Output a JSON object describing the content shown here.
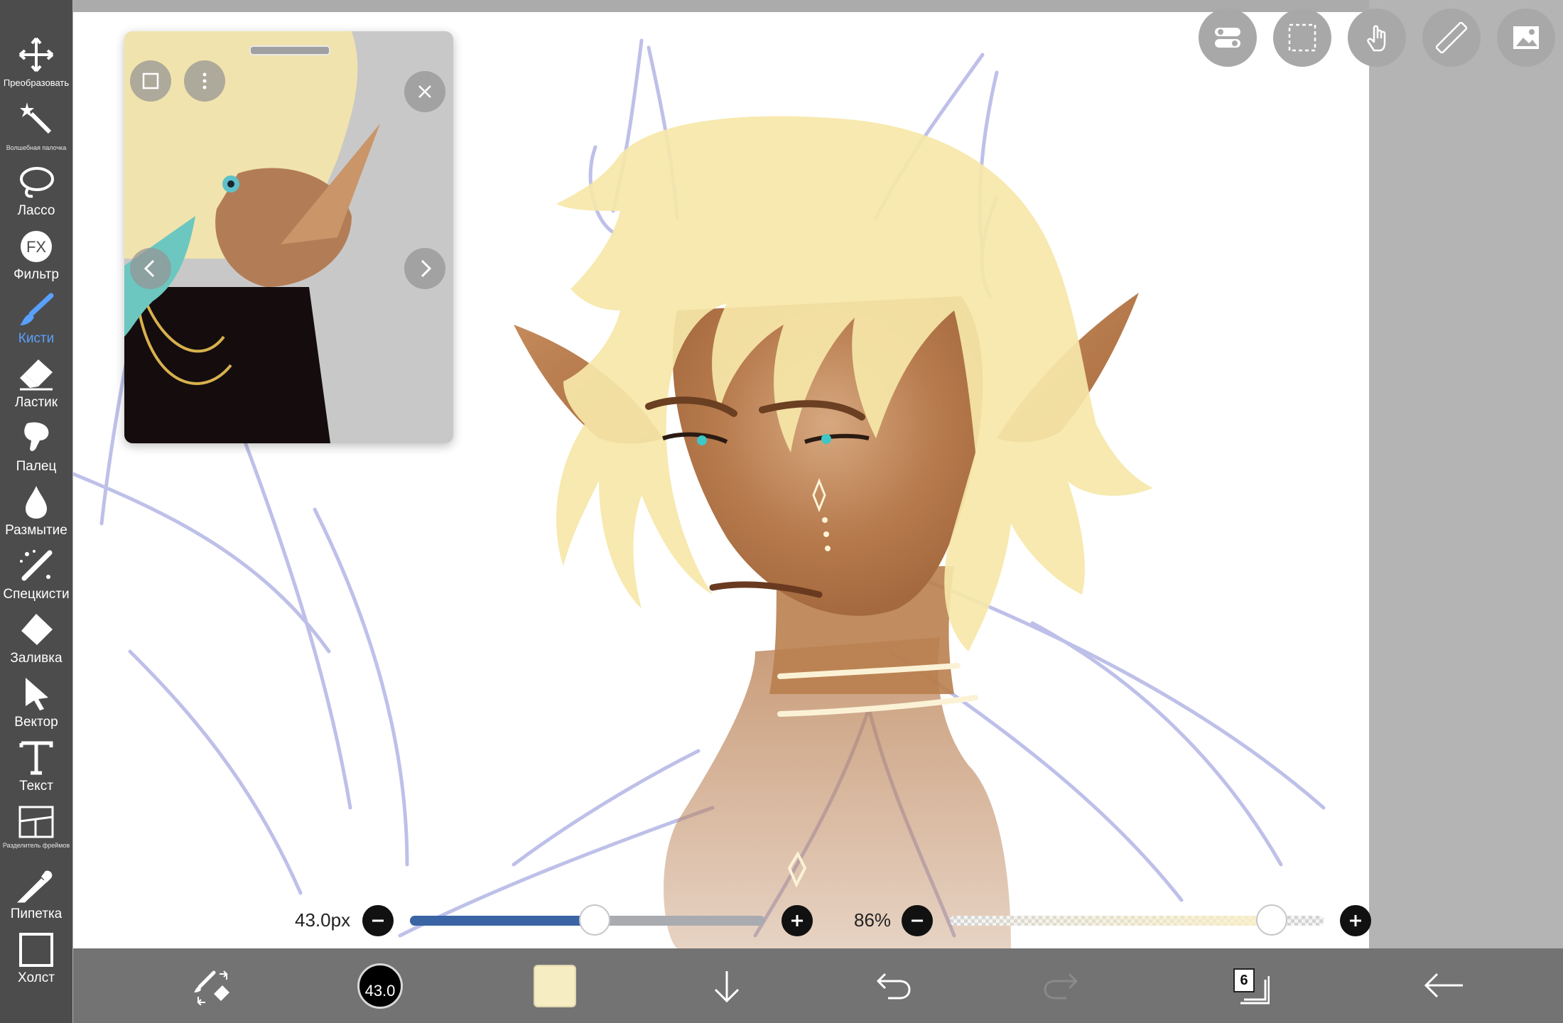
{
  "sidebar": {
    "tools": [
      {
        "id": "transform",
        "label": "Преобразовать",
        "icon": "move-arrows-icon"
      },
      {
        "id": "magic-wand",
        "label": "Волшебная палочка",
        "icon": "magic-wand-icon"
      },
      {
        "id": "lasso",
        "label": "Лассо",
        "icon": "lasso-icon"
      },
      {
        "id": "filter",
        "label": "Фильтр",
        "icon": "fx-icon"
      },
      {
        "id": "brush",
        "label": "Кисти",
        "icon": "brush-icon",
        "active": true
      },
      {
        "id": "eraser",
        "label": "Ластик",
        "icon": "eraser-icon"
      },
      {
        "id": "finger",
        "label": "Палец",
        "icon": "smudge-finger-icon"
      },
      {
        "id": "blur",
        "label": "Размытие",
        "icon": "blur-drop-icon"
      },
      {
        "id": "special-brush",
        "label": "Спецкисти",
        "icon": "special-brush-icon"
      },
      {
        "id": "fill",
        "label": "Заливка",
        "icon": "fill-bucket-icon"
      },
      {
        "id": "vector",
        "label": "Вектор",
        "icon": "vector-cursor-icon"
      },
      {
        "id": "text",
        "label": "Текст",
        "icon": "text-T-icon"
      },
      {
        "id": "frame-divider",
        "label": "Разделитель фреймов",
        "icon": "frame-divider-icon"
      },
      {
        "id": "eyedropper",
        "label": "Пипетка",
        "icon": "eyedropper-icon"
      },
      {
        "id": "canvas",
        "label": "Холст",
        "icon": "canvas-icon"
      }
    ]
  },
  "top_actions": [
    {
      "id": "toggles",
      "icon": "toggle-switches-icon"
    },
    {
      "id": "selection",
      "icon": "selection-rect-icon"
    },
    {
      "id": "touch",
      "icon": "hand-touch-icon"
    },
    {
      "id": "ruler",
      "icon": "ruler-icon"
    },
    {
      "id": "material",
      "icon": "image-icon"
    }
  ],
  "reference_window": {
    "buttons": [
      "frame-icon",
      "more-vertical-icon",
      "close-icon",
      "chevron-left-icon",
      "chevron-right-icon"
    ]
  },
  "brush_size": {
    "label": "43.0px",
    "value": 43.0,
    "fraction": 0.52
  },
  "opacity": {
    "label": "86%",
    "value": 86,
    "fraction": 0.86
  },
  "bottom_bar": {
    "brush_size_value": "43.0",
    "current_color": "#f7edc2",
    "layer_count": "6",
    "icons": [
      "swap-brush-eraser-icon",
      "brush-size-icon",
      "color-swatch",
      "arrow-down-icon",
      "undo-icon",
      "redo-icon",
      "layers-icon",
      "back-arrow-icon"
    ]
  },
  "colors": {
    "sidebar_bg": "#4c4c4c",
    "active_tool": "#5aa0ff",
    "size_slider": "#3a64a4",
    "bottom_bar": "#6e6e6e"
  }
}
